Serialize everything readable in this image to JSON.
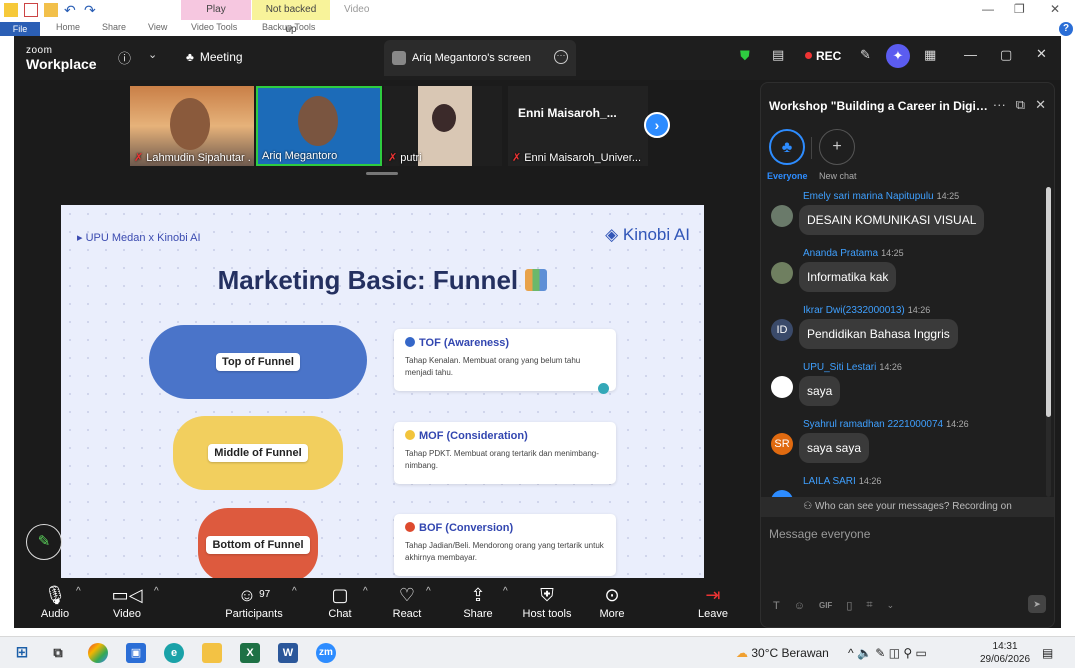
{
  "ppt": {
    "ctx_play": "Play",
    "ctx_backup": "Not backed up",
    "ctx_video": "Video",
    "tabs": [
      "File",
      "Home",
      "Share",
      "View",
      "Video Tools",
      "Backup Tools"
    ]
  },
  "zoom": {
    "logo_top": "zoom",
    "logo_bottom": "Workplace",
    "meeting_label": "Meeting",
    "screen_tab": "Ariq Megantoro's screen",
    "rec_label": "REC"
  },
  "participants": [
    {
      "name": "Lahmudin Sipahutar . ..."
    },
    {
      "name": "Ariq Megantoro"
    },
    {
      "name": "putri"
    },
    {
      "name": "Enni Maisaroh_Univer...",
      "display": "Enni  Maisaroh_..."
    }
  ],
  "slide": {
    "crumb": "UPU Medan x Kinobi AI",
    "brand": "Kinobi AI",
    "title": "Marketing Basic: Funnel",
    "funnels": [
      {
        "label": "Top of Funnel",
        "color": "#4a74c9"
      },
      {
        "label": "Middle of Funnel",
        "color": "#f2cf5e"
      },
      {
        "label": "Bottom of Funnel",
        "color": "#dd5a3e"
      }
    ],
    "cards": [
      {
        "heading": "TOF (Awareness)",
        "dot": "#3567c8",
        "text": "Tahap Kenalan. Membuat orang yang belum tahu menjadi tahu."
      },
      {
        "heading": "MOF (Consideration)",
        "dot": "#f2c43c",
        "text": "Tahap PDKT. Membuat orang tertarik dan menimbang-nimbang."
      },
      {
        "heading": "BOF (Conversion)",
        "dot": "#dd4a2e",
        "text": "Tahap Jadian/Beli. Mendorong orang yang tertarik untuk akhirnya membayar."
      }
    ]
  },
  "toolbar": {
    "audio": "Audio",
    "video": "Video",
    "participants": "Participants",
    "participants_count": "97",
    "chat": "Chat",
    "react": "React",
    "share": "Share",
    "host_tools": "Host tools",
    "more": "More",
    "leave": "Leave"
  },
  "chat": {
    "title": "Workshop \"Building a Career in Digital Ma...",
    "tab_everyone": "Everyone",
    "tab_new": "New chat",
    "messages": [
      {
        "sender": "Emely sari marina Napitupulu",
        "time": "14:25",
        "text": "DESAIN KOMUNIKASI VISUAL",
        "avatar": "",
        "avcolor": "#6a7a6a"
      },
      {
        "sender": "Ananda Pratama",
        "time": "14:25",
        "text": "Informatika kak",
        "avatar": "",
        "avcolor": "#6f7f60"
      },
      {
        "sender": "Ikrar Dwi(2332000013)",
        "time": "14:26",
        "text": "Pendidikan Bahasa Inggris",
        "avatar": "ID",
        "avcolor": "#3a4a6a"
      },
      {
        "sender": "UPU_Siti Lestari",
        "time": "14:26",
        "text": "saya",
        "avatar": "",
        "avcolor": "#ffffff"
      },
      {
        "sender": "Syahrul ramadhan 2221000074",
        "time": "14:26",
        "text": "saya saya",
        "avatar": "SR",
        "avcolor": "#e06a10"
      },
      {
        "sender": "LAILA SARI",
        "time": "14:26",
        "text": "",
        "avatar": "",
        "avcolor": "#2d8cff"
      }
    ],
    "privacy": "Who can see your messages? Recording on",
    "placeholder": "Message everyone"
  },
  "taskbar": {
    "weather": "30°C  Berawan",
    "time": "14:31",
    "date": "29/06/2026"
  }
}
